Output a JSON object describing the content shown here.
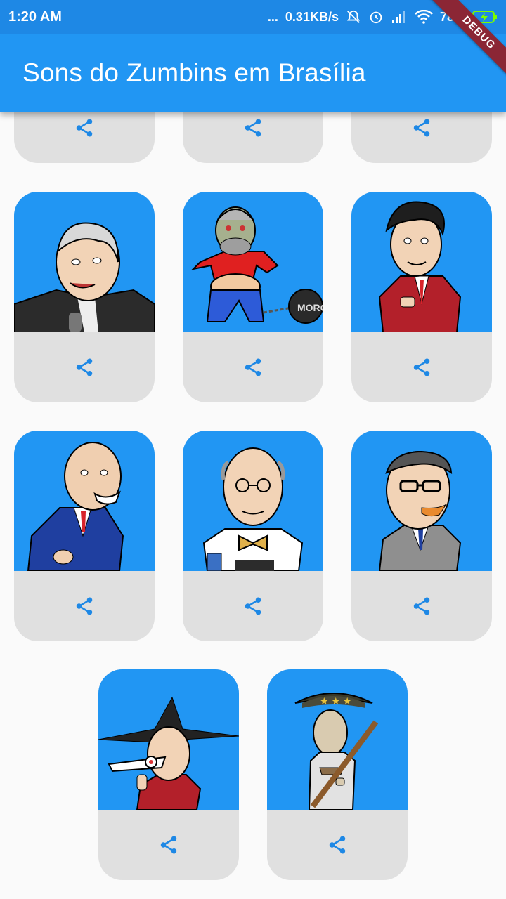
{
  "status_bar": {
    "time": "1:20 AM",
    "dots": "...",
    "network_speed": "0.31KB/s",
    "battery": "78%"
  },
  "app_bar": {
    "title": "Sons do Zumbins em Brasília"
  },
  "debug_banner": "DEBUG",
  "colors": {
    "primary": "#2196f3",
    "status_bar": "#1e88e5",
    "card_footer": "#e0e0e0",
    "share_icon": "#1e88e5",
    "debug_ribbon": "#8b2635"
  },
  "cards": [
    {
      "id": "card-1",
      "image": "caricature-partial-top",
      "share_icon": "share-icon"
    },
    {
      "id": "card-2",
      "image": "caricature-partial-top",
      "share_icon": "share-icon"
    },
    {
      "id": "card-3",
      "image": "caricature-partial-top",
      "share_icon": "share-icon"
    },
    {
      "id": "card-4",
      "image": "caricature-grey-haired-man-suit",
      "share_icon": "share-icon"
    },
    {
      "id": "card-5",
      "image": "caricature-man-ball-and-chain",
      "share_icon": "share-icon",
      "ball_text": "MORO"
    },
    {
      "id": "card-6",
      "image": "caricature-man-red-suit",
      "share_icon": "share-icon"
    },
    {
      "id": "card-7",
      "image": "caricature-bald-man-blue-suit",
      "share_icon": "share-icon"
    },
    {
      "id": "card-8",
      "image": "caricature-old-man-bow-tie",
      "share_icon": "share-icon"
    },
    {
      "id": "card-9",
      "image": "caricature-man-glasses-grey-suit",
      "share_icon": "share-icon"
    },
    {
      "id": "card-10",
      "image": "caricature-man-airplane",
      "share_icon": "share-icon"
    },
    {
      "id": "card-11",
      "image": "caricature-soldier-rifle",
      "share_icon": "share-icon"
    }
  ]
}
